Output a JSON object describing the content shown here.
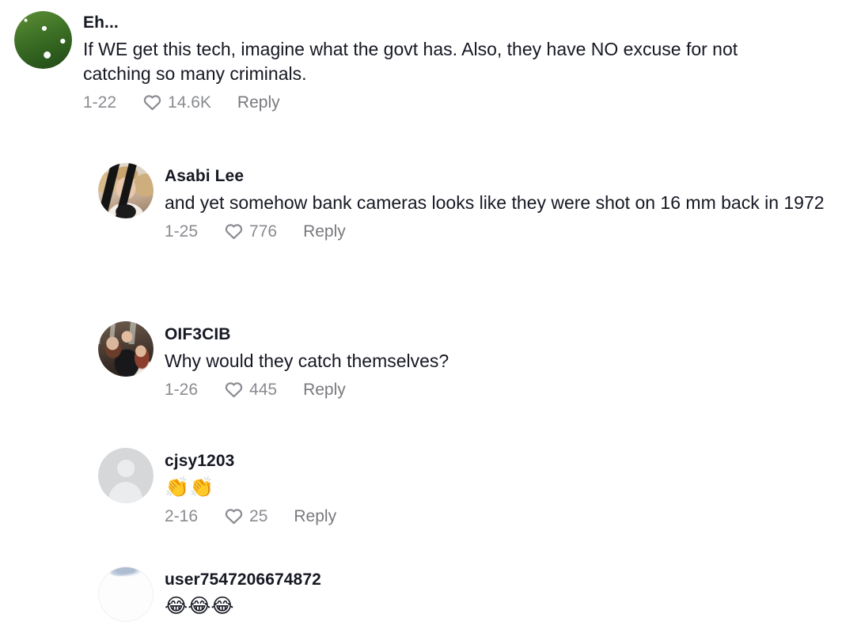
{
  "page": {
    "title": "Comment thread",
    "background_color": "#ffffff",
    "text_color": "#161823",
    "meta_color": "#8a8b91",
    "reply_color": "#78797e"
  },
  "icons": {
    "heart": "heart-outline-icon",
    "default_avatar": "person-silhouette-icon"
  },
  "comments": [
    {
      "id": "comment-eh",
      "level": 0,
      "avatar": "daisies-in-grass-photo",
      "username": "Eh...",
      "text": "If WE get this tech, imagine what the govt has. Also, they have NO excuse for not catching so many criminals.",
      "date": "1-22",
      "likes": "14.6K",
      "reply_label": "Reply"
    },
    {
      "id": "comment-asabi-lee",
      "level": 1,
      "avatar": "blonde-person-striped-top-photo",
      "username": "Asabi Lee",
      "text": "and yet somehow bank cameras looks like they were shot on 16 mm back in 1972",
      "date": "1-25",
      "likes": "776",
      "reply_label": "Reply"
    },
    {
      "id": "comment-oif3cib",
      "level": 1,
      "avatar": "group-photo",
      "username": "OIF3CIB",
      "text": "Why would they catch themselves?",
      "date": "1-26",
      "likes": "445",
      "reply_label": "Reply"
    },
    {
      "id": "comment-cjsy1203",
      "level": 1,
      "avatar": "default-gray-avatar",
      "username": "cjsy1203",
      "text": "👏👏",
      "emoji_only": true,
      "date": "2-16",
      "likes": "25",
      "reply_label": "Reply"
    },
    {
      "id": "comment-user7547206674872",
      "level": 1,
      "avatar": "pale-sky-avatar",
      "username": "user7547206674872",
      "text": "😂😂😂",
      "emoji_only": true
    }
  ]
}
